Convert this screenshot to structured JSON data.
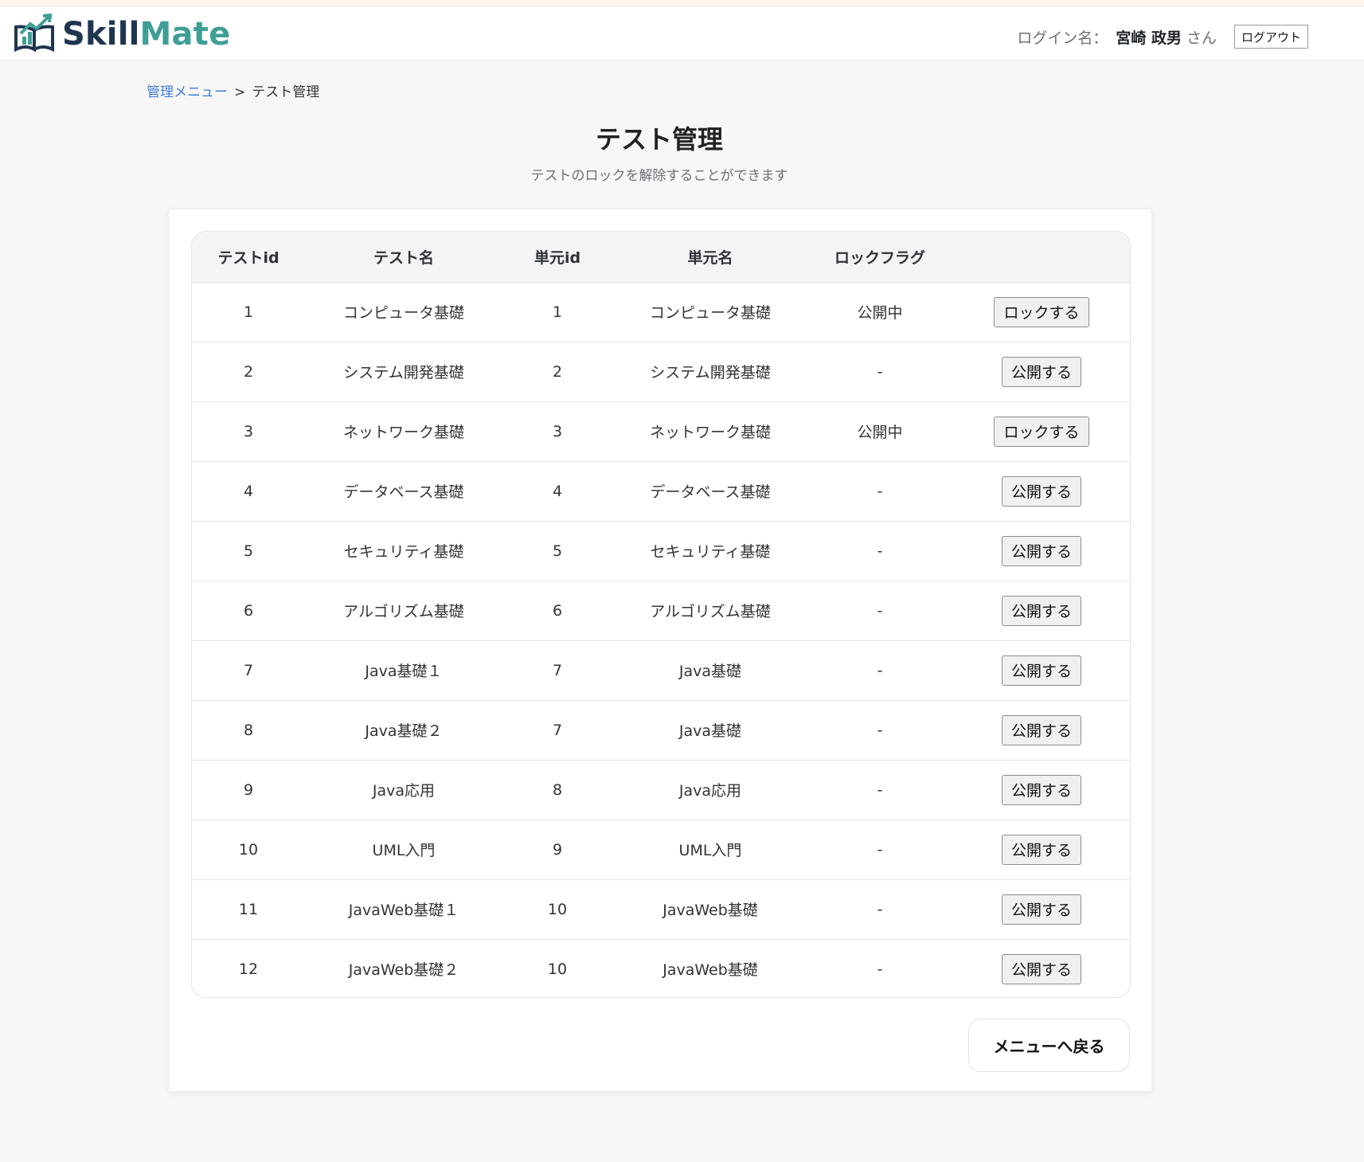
{
  "header": {
    "logo_part1": "Skill",
    "logo_part2": "Mate",
    "login_label": "ログイン名：",
    "user_name": "宮崎 政男",
    "user_suffix": "さん",
    "logout_label": "ログアウト"
  },
  "breadcrumb": {
    "parent": "管理メニュー",
    "separator": ">",
    "current": "テスト管理"
  },
  "page": {
    "title": "テスト管理",
    "subtitle": "テストのロックを解除することができます"
  },
  "table": {
    "headers": [
      "テストid",
      "テスト名",
      "単元id",
      "単元名",
      "ロックフラグ",
      ""
    ],
    "rows": [
      {
        "id": "1",
        "name": "コンピュータ基礎",
        "unit_id": "1",
        "unit_name": "コンピュータ基礎",
        "flag": "公開中",
        "action": "ロックする"
      },
      {
        "id": "2",
        "name": "システム開発基礎",
        "unit_id": "2",
        "unit_name": "システム開発基礎",
        "flag": "-",
        "action": "公開する"
      },
      {
        "id": "3",
        "name": "ネットワーク基礎",
        "unit_id": "3",
        "unit_name": "ネットワーク基礎",
        "flag": "公開中",
        "action": "ロックする"
      },
      {
        "id": "4",
        "name": "データベース基礎",
        "unit_id": "4",
        "unit_name": "データベース基礎",
        "flag": "-",
        "action": "公開する"
      },
      {
        "id": "5",
        "name": "セキュリティ基礎",
        "unit_id": "5",
        "unit_name": "セキュリティ基礎",
        "flag": "-",
        "action": "公開する"
      },
      {
        "id": "6",
        "name": "アルゴリズム基礎",
        "unit_id": "6",
        "unit_name": "アルゴリズム基礎",
        "flag": "-",
        "action": "公開する"
      },
      {
        "id": "7",
        "name": "Java基礎１",
        "unit_id": "7",
        "unit_name": "Java基礎",
        "flag": "-",
        "action": "公開する"
      },
      {
        "id": "8",
        "name": "Java基礎２",
        "unit_id": "7",
        "unit_name": "Java基礎",
        "flag": "-",
        "action": "公開する"
      },
      {
        "id": "9",
        "name": "Java応用",
        "unit_id": "8",
        "unit_name": "Java応用",
        "flag": "-",
        "action": "公開する"
      },
      {
        "id": "10",
        "name": "UML入門",
        "unit_id": "9",
        "unit_name": "UML入門",
        "flag": "-",
        "action": "公開する"
      },
      {
        "id": "11",
        "name": "JavaWeb基礎１",
        "unit_id": "10",
        "unit_name": "JavaWeb基礎",
        "flag": "-",
        "action": "公開する"
      },
      {
        "id": "12",
        "name": "JavaWeb基礎２",
        "unit_id": "10",
        "unit_name": "JavaWeb基礎",
        "flag": "-",
        "action": "公開する"
      }
    ]
  },
  "footer": {
    "back_label": "メニューへ戻る"
  },
  "colors": {
    "logo_dark": "#1f3550",
    "logo_teal": "#3f9e96",
    "link": "#3d7bdc"
  }
}
